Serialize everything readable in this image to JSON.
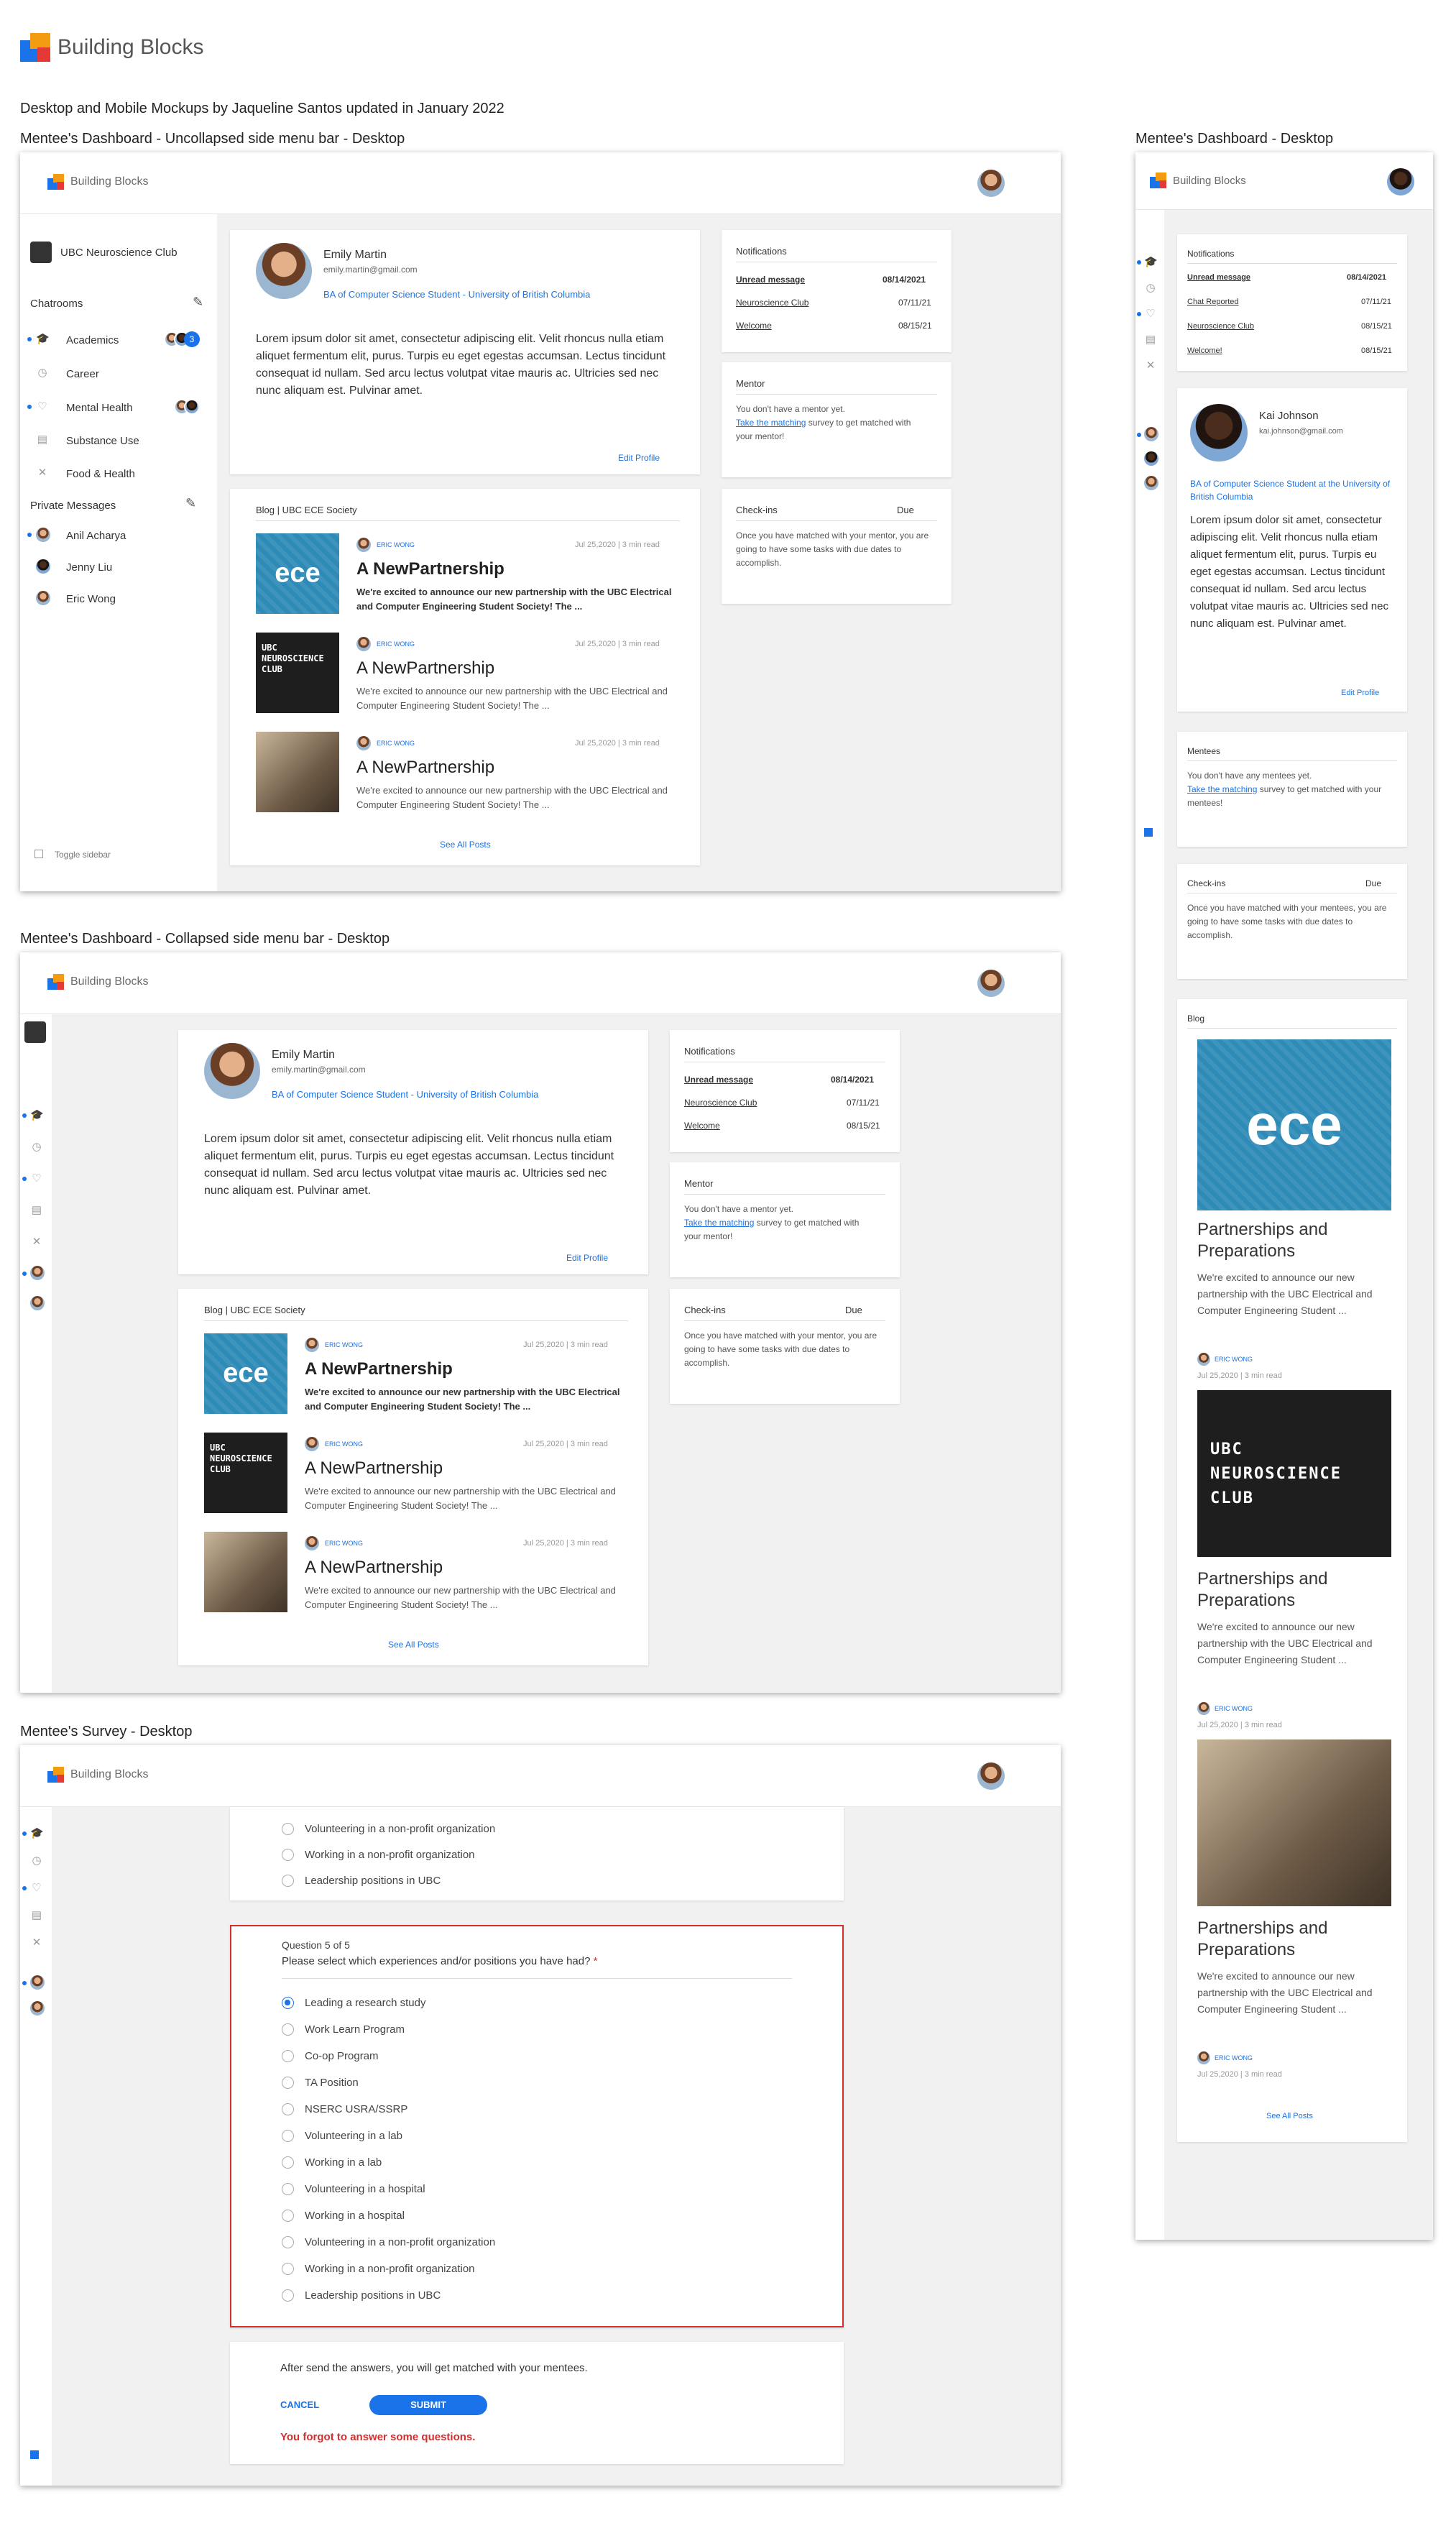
{
  "brand": {
    "name": "Building Blocks"
  },
  "header_note": "Desktop and Mobile Mockups by Jaqueline Santos updated in January 2022",
  "frame_titles": {
    "uncollapsed": "Mentee's Dashboard - Uncollapsed side menu bar - Desktop",
    "collapsed": "Mentee's Dashboard - Collapsed side menu bar - Desktop",
    "survey": "Mentee's Survey - Desktop",
    "mobile": "Mentee's Dashboard - Desktop"
  },
  "sidebar": {
    "club": "UBC Neuroscience Club",
    "chatrooms_label": "Chatrooms",
    "chatrooms": [
      "Academics",
      "Career",
      "Mental Health",
      "Substance Use",
      "Food & Health"
    ],
    "pm_label": "Private Messages",
    "private_messages": [
      "Anil Acharya",
      "Jenny Liu",
      "Eric Wong"
    ],
    "toggle": "Toggle sidebar",
    "badge_count": "3"
  },
  "profile": {
    "name": "Emily Martin",
    "email": "emily.martin@gmail.com",
    "program": "BA of Computer Science Student - University of British Columbia",
    "bio": "Lorem ipsum dolor sit amet, consectetur adipiscing elit. Velit rhoncus nulla etiam aliquet fermentum elit, purus. Turpis eu eget egestas accumsan. Lectus tincidunt consequat id nullam. Sed arcu lectus volutpat vitae mauris ac. Ultricies sed nec nunc aliquam est. Pulvinar amet.",
    "edit": "Edit Profile"
  },
  "profile_mobile": {
    "name": "Kai Johnson",
    "email": "kai.johnson@gmail.com",
    "program": "BA of Computer Science Student at the University of British Columbia"
  },
  "notifications": {
    "title": "Notifications",
    "rows": [
      {
        "label": "Unread message",
        "date": "08/14/2021",
        "bold": true
      },
      {
        "label": "Neuroscience Club",
        "date": "07/11/21",
        "bold": false
      },
      {
        "label": "Welcome",
        "date": "08/15/21",
        "bold": false
      }
    ],
    "mobile_rows": [
      {
        "label": "Unread message",
        "date": "08/14/2021"
      },
      {
        "label": "Chat Reported",
        "date": "07/11/21"
      },
      {
        "label": "Neuroscience Club",
        "date": "08/15/21"
      },
      {
        "label": "Welcome!",
        "date": "08/15/21"
      }
    ]
  },
  "mentor": {
    "title": "Mentor",
    "line1": "You don't have a mentor yet.",
    "link": "Take the matching",
    "line2": "survey to get matched with your mentor!"
  },
  "mentees": {
    "title": "Mentees",
    "line1": "You don't have any mentees yet.",
    "link": "Take the matching",
    "line2": "survey to get matched with your mentees!"
  },
  "checkins": {
    "title": "Check-ins",
    "due": "Due",
    "text": "Once you have matched with your mentor, you are going to have some tasks with due dates to accomplish.",
    "text_mobile": "Once you have matched with your mentees, you are going to have some tasks with due dates to accomplish."
  },
  "blog": {
    "title": "Blog | UBC ECE Society",
    "title_mobile": "Blog",
    "author": "ERIC WONG",
    "meta": "Jul 25,2020 | 3 min read",
    "post_title": "A NewPartnership",
    "excerpt": "We're excited to announce our new partnership with the UBC Electrical and Computer Engineering Student Society! The ...",
    "see_all": "See All Posts",
    "mobile_title": "Partnerships and Preparations",
    "mobile_excerpt": "We're excited to announce our new partnership with the UBC Electrical and Computer Engineering Student ...",
    "ece_logo": "ece",
    "ubc_logo": "UBC NEUROSCIENCE CLUB"
  },
  "survey": {
    "prev_options": [
      "Volunteering in a non-profit organization",
      "Working in a non-profit organization",
      "Leadership positions in UBC"
    ],
    "question_num": "Question 5 of 5",
    "question": "Please select which experiences and/or positions you have had?",
    "required": "*",
    "options": [
      "Leading a research study",
      "Work Learn Program",
      "Co-op Program",
      "TA Position",
      "NSERC USRA/SSRP",
      "Volunteering in a lab",
      "Working in a lab",
      "Volunteering in a hospital",
      "Working in a hospital",
      "Volunteering in a non-profit organization",
      "Working in a non-profit organization",
      "Leadership positions in UBC"
    ],
    "after": "After send the answers, you will get matched with your mentees.",
    "cancel": "CANCEL",
    "submit": "SUBMIT",
    "error": "You forgot to answer some questions."
  },
  "colors": {
    "accent": "#1a73e8",
    "error": "#d32f2f",
    "page_bg": "#f1f1f1"
  }
}
